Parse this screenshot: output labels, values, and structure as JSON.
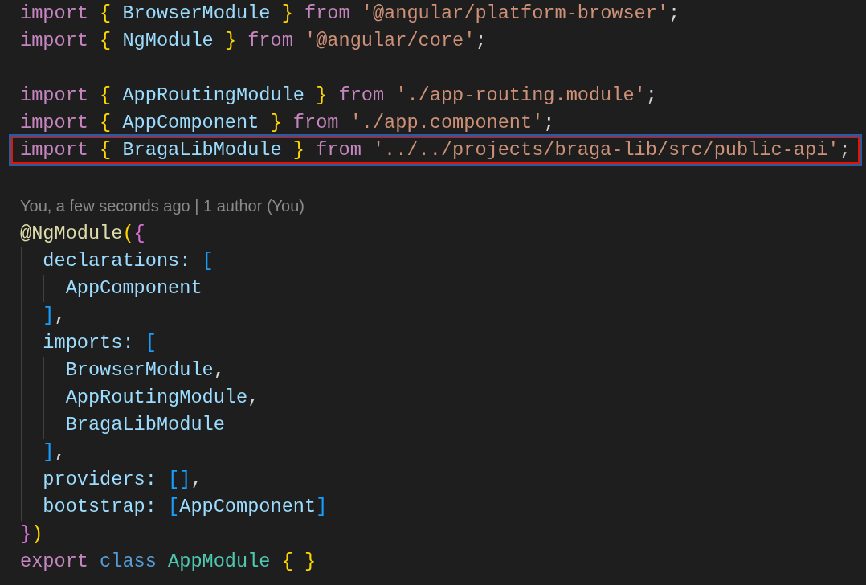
{
  "editor": {
    "lines": [
      {
        "kind": "code",
        "highlighted": false,
        "tokens": [
          {
            "text": "import",
            "kind": "keyword"
          },
          {
            "text": " {",
            "kind": "brace"
          },
          {
            "text": " BrowserModule ",
            "kind": "identifier"
          },
          {
            "text": "}",
            "kind": "brace"
          },
          {
            "text": " from ",
            "kind": "keyword"
          },
          {
            "text": "'@angular/platform-browser'",
            "kind": "string"
          },
          {
            "text": ";",
            "kind": "plain"
          }
        ]
      },
      {
        "kind": "code",
        "highlighted": false,
        "tokens": [
          {
            "text": "import",
            "kind": "keyword"
          },
          {
            "text": " {",
            "kind": "brace"
          },
          {
            "text": " NgModule ",
            "kind": "identifier"
          },
          {
            "text": "}",
            "kind": "brace"
          },
          {
            "text": " from ",
            "kind": "keyword"
          },
          {
            "text": "'@angular/core'",
            "kind": "string"
          },
          {
            "text": ";",
            "kind": "plain"
          }
        ]
      },
      {
        "kind": "blank"
      },
      {
        "kind": "code",
        "highlighted": false,
        "tokens": [
          {
            "text": "import",
            "kind": "keyword"
          },
          {
            "text": " {",
            "kind": "brace"
          },
          {
            "text": " AppRoutingModule ",
            "kind": "identifier"
          },
          {
            "text": "}",
            "kind": "brace"
          },
          {
            "text": " from ",
            "kind": "keyword"
          },
          {
            "text": "'./app-routing.module'",
            "kind": "string"
          },
          {
            "text": ";",
            "kind": "plain"
          }
        ]
      },
      {
        "kind": "code",
        "highlighted": false,
        "tokens": [
          {
            "text": "import",
            "kind": "keyword"
          },
          {
            "text": " {",
            "kind": "brace"
          },
          {
            "text": " AppComponent ",
            "kind": "identifier"
          },
          {
            "text": "}",
            "kind": "brace"
          },
          {
            "text": " from ",
            "kind": "keyword"
          },
          {
            "text": "'./app.component'",
            "kind": "string"
          },
          {
            "text": ";",
            "kind": "plain"
          }
        ]
      },
      {
        "kind": "code",
        "highlighted": true,
        "tokens": [
          {
            "text": "import",
            "kind": "keyword"
          },
          {
            "text": " {",
            "kind": "brace"
          },
          {
            "text": " BragaLibModule ",
            "kind": "identifier"
          },
          {
            "text": "}",
            "kind": "brace"
          },
          {
            "text": " from ",
            "kind": "keyword"
          },
          {
            "text": "'../../projects/braga-lib/src/public-api'",
            "kind": "string"
          },
          {
            "text": ";",
            "kind": "plain"
          }
        ]
      },
      {
        "kind": "blank"
      },
      {
        "kind": "blame",
        "text": "You, a few seconds ago | 1 author (You)"
      },
      {
        "kind": "code",
        "highlighted": false,
        "tokens": [
          {
            "text": "@NgModule",
            "kind": "decorator"
          },
          {
            "text": "(",
            "kind": "brace"
          },
          {
            "text": "{",
            "kind": "brace2"
          }
        ]
      },
      {
        "kind": "code",
        "highlighted": false,
        "tokens": [
          {
            "text": "  declarations: ",
            "kind": "identifier"
          },
          {
            "text": "[",
            "kind": "brace3"
          }
        ]
      },
      {
        "kind": "code",
        "highlighted": false,
        "tokens": [
          {
            "text": "    AppComponent",
            "kind": "identifier"
          }
        ]
      },
      {
        "kind": "code",
        "highlighted": false,
        "tokens": [
          {
            "text": "  ]",
            "kind": "brace3"
          },
          {
            "text": ",",
            "kind": "plain"
          }
        ]
      },
      {
        "kind": "code",
        "highlighted": false,
        "tokens": [
          {
            "text": "  imports: ",
            "kind": "identifier"
          },
          {
            "text": "[",
            "kind": "brace3"
          }
        ]
      },
      {
        "kind": "code",
        "highlighted": false,
        "tokens": [
          {
            "text": "    BrowserModule",
            "kind": "identifier"
          },
          {
            "text": ",",
            "kind": "plain"
          }
        ]
      },
      {
        "kind": "code",
        "highlighted": false,
        "tokens": [
          {
            "text": "    AppRoutingModule",
            "kind": "identifier"
          },
          {
            "text": ",",
            "kind": "plain"
          }
        ]
      },
      {
        "kind": "code",
        "highlighted": false,
        "tokens": [
          {
            "text": "    BragaLibModule",
            "kind": "identifier"
          }
        ]
      },
      {
        "kind": "code",
        "highlighted": false,
        "tokens": [
          {
            "text": "  ]",
            "kind": "brace3"
          },
          {
            "text": ",",
            "kind": "plain"
          }
        ]
      },
      {
        "kind": "code",
        "highlighted": false,
        "tokens": [
          {
            "text": "  providers: ",
            "kind": "identifier"
          },
          {
            "text": "[]",
            "kind": "brace3"
          },
          {
            "text": ",",
            "kind": "plain"
          }
        ]
      },
      {
        "kind": "code",
        "highlighted": false,
        "tokens": [
          {
            "text": "  bootstrap: ",
            "kind": "identifier"
          },
          {
            "text": "[",
            "kind": "brace3"
          },
          {
            "text": "AppComponent",
            "kind": "identifier"
          },
          {
            "text": "]",
            "kind": "brace3"
          }
        ]
      },
      {
        "kind": "code",
        "highlighted": false,
        "tokens": [
          {
            "text": "}",
            "kind": "brace2"
          },
          {
            "text": ")",
            "kind": "brace"
          }
        ]
      },
      {
        "kind": "code",
        "highlighted": false,
        "tokens": [
          {
            "text": "export",
            "kind": "keyword"
          },
          {
            "text": " class",
            "kind": "storage"
          },
          {
            "text": " AppModule",
            "kind": "class"
          },
          {
            "text": " { }",
            "kind": "brace"
          }
        ]
      }
    ]
  }
}
